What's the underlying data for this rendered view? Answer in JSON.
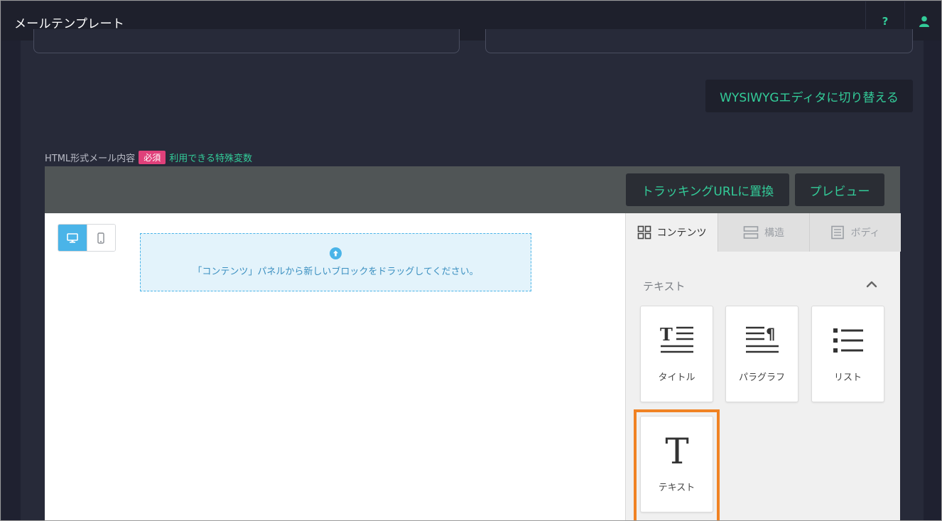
{
  "header": {
    "title": "メールテンプレート",
    "help_label": "?"
  },
  "editor_switch": {
    "label": "WYSIWYGエディタに切り替える"
  },
  "field": {
    "label": "HTML形式メール内容",
    "required_badge": "必須",
    "variables_link": "利用できる特殊変数"
  },
  "toolbar": {
    "tracking_label": "トラッキングURLに置換",
    "preview_label": "プレビュー"
  },
  "canvas": {
    "dropzone_text": "「コンテンツ」パネルから新しいブロックをドラッグしてください。"
  },
  "panel": {
    "tabs": [
      {
        "label": "コンテンツ",
        "icon": "grid-icon",
        "active": true
      },
      {
        "label": "構造",
        "icon": "rows-icon",
        "active": false
      },
      {
        "label": "ボディ",
        "icon": "document-icon",
        "active": false
      }
    ],
    "section_title": "テキスト",
    "blocks": [
      {
        "label": "タイトル",
        "icon": "title-icon"
      },
      {
        "label": "パラグラフ",
        "icon": "paragraph-icon"
      },
      {
        "label": "リスト",
        "icon": "list-icon"
      },
      {
        "label": "テキスト",
        "icon": "text-icon"
      }
    ]
  },
  "colors": {
    "accent": "#33cc99",
    "info": "#4ab4e8",
    "badge": "#e0407a",
    "highlight": "#f08223"
  }
}
